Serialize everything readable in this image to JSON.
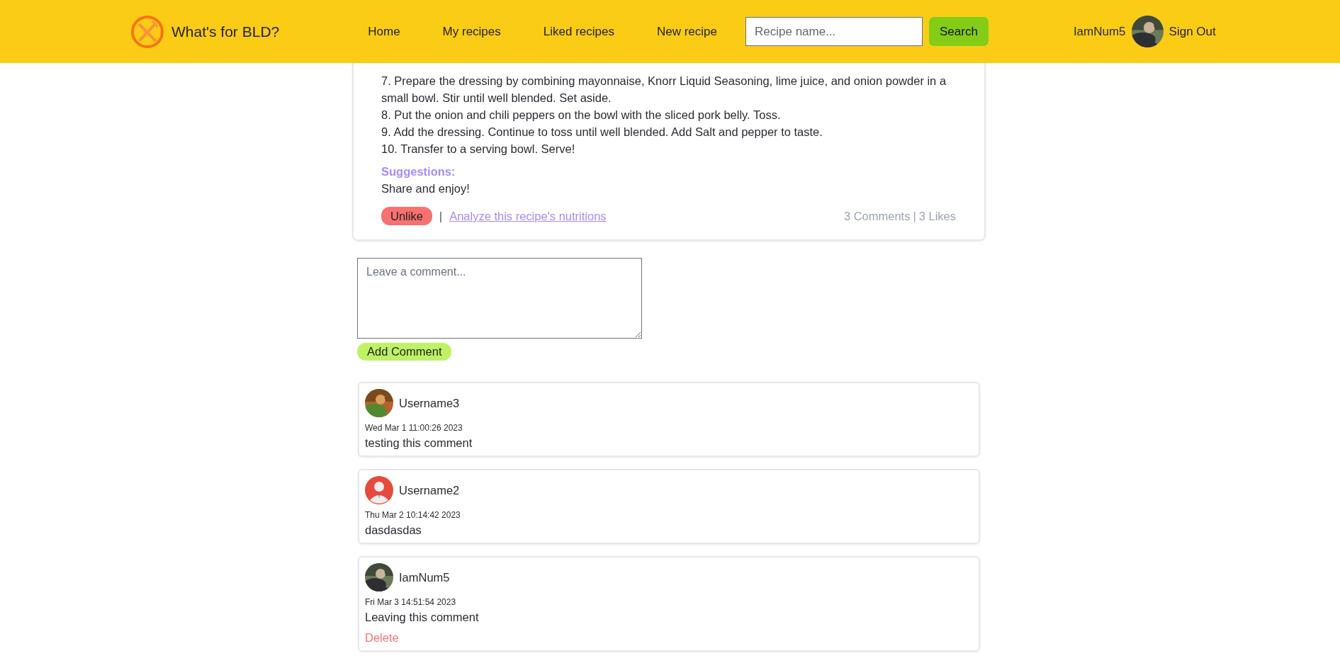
{
  "header": {
    "brand": "What's for BLD?",
    "nav": [
      "Home",
      "My recipes",
      "Liked recipes",
      "New recipe"
    ],
    "search": {
      "placeholder": "Recipe name...",
      "button": "Search"
    },
    "user": {
      "name": "IamNum5"
    },
    "sign_out": "Sign Out"
  },
  "recipe": {
    "steps": [
      "7. Prepare the dressing by combining mayonnaise, Knorr Liquid Seasoning, lime juice, and onion powder in a small bowl. Stir until well blended. Set aside.",
      "8. Put the onion and chili peppers on the bowl with the sliced pork belly. Toss.",
      "9. Add the dressing. Continue to toss until well blended. Add Salt and pepper to taste.",
      "10. Transfer to a serving bowl. Serve!"
    ],
    "suggestions_label": "Suggestions:",
    "suggestions": "Share and enjoy!",
    "like_button": "Unlike",
    "separator": "|",
    "analyze_link": "Analyze this recipe's nutritions",
    "comments_count": "3 Comments",
    "likes_count": "3 Likes"
  },
  "comment_form": {
    "placeholder": "Leave a comment...",
    "button": "Add Comment"
  },
  "comments": [
    {
      "username": "Username3",
      "date": "Wed Mar 1 11:00:26 2023",
      "text": "testing this comment"
    },
    {
      "username": "Username2",
      "avatar": {
        "kind": "icon"
      },
      "date": "Thu Mar 2 10:14:42 2023",
      "text": "dasdasdas"
    },
    {
      "username": "IamNum5",
      "date": "Fri Mar 3 14:51:54 2023",
      "text": "Leaving this comment",
      "actions": [
        "Delete"
      ]
    }
  ]
}
